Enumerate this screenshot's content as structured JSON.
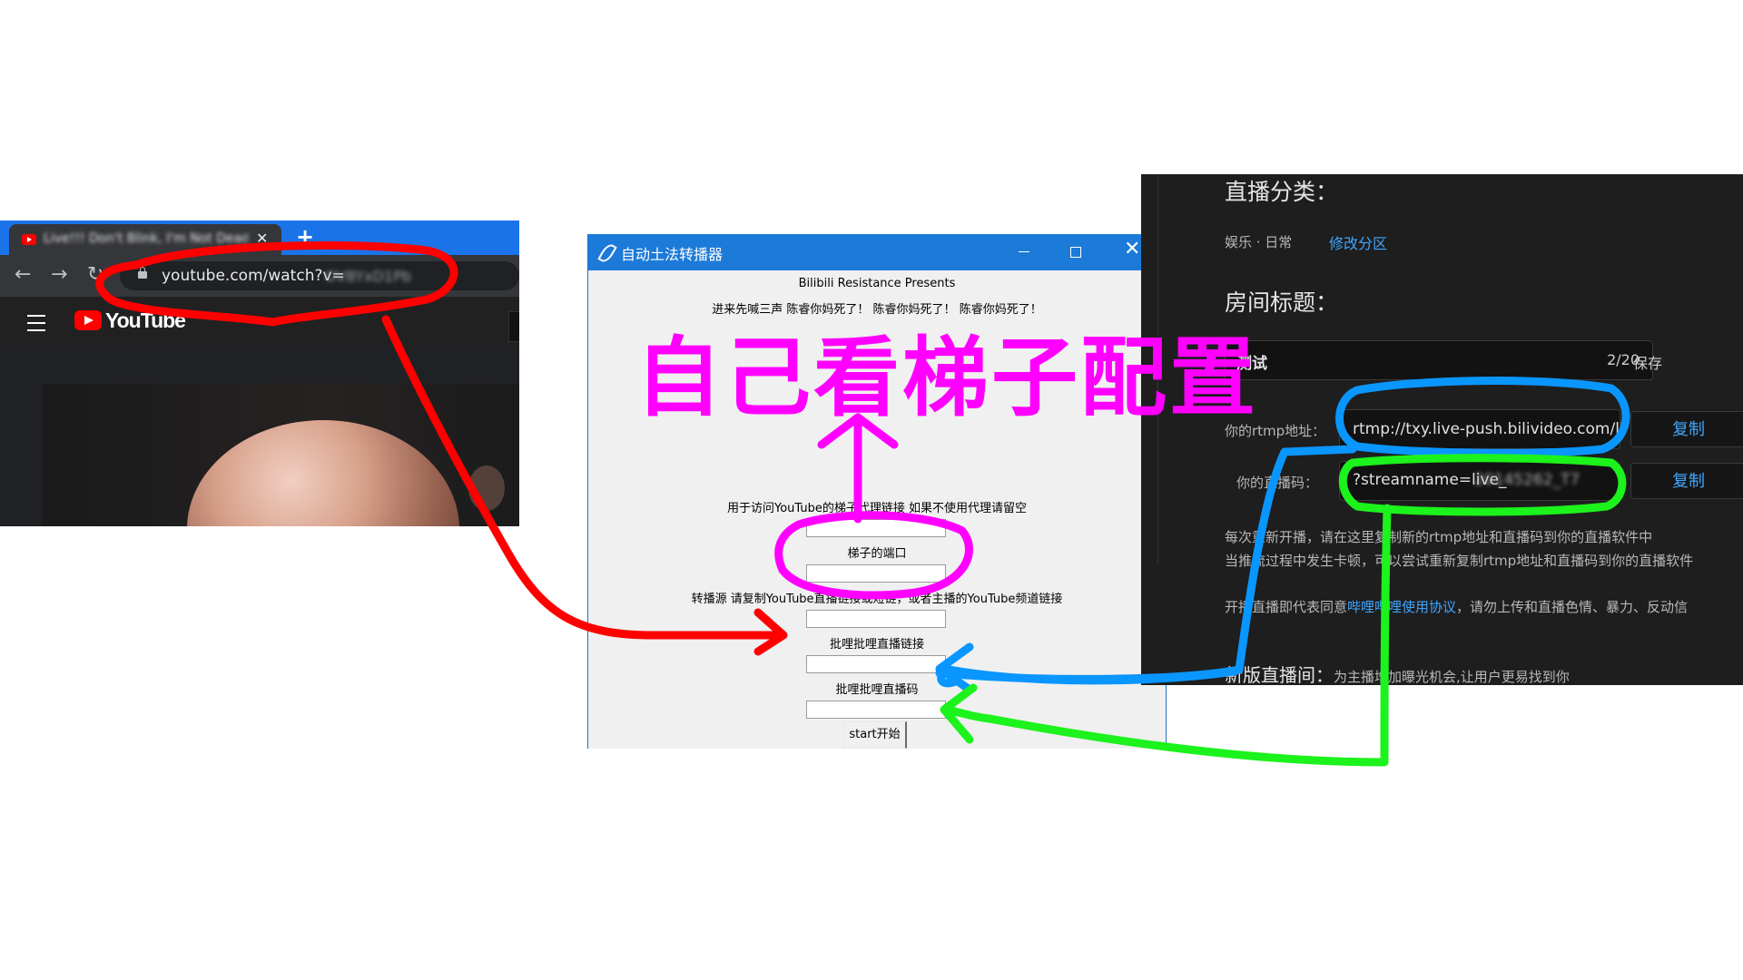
{
  "browser": {
    "tab_title": "Live!!! Don't Blink, I'm Not Dead!",
    "url_visible": "youtube.com/watch?v=",
    "url_blurred": "OVBYxD1Pb",
    "site_logo_text": "YouTube",
    "icons": [
      "youtube-favicon",
      "close-icon",
      "plus-icon",
      "back-arrow-icon",
      "forward-arrow-icon",
      "reload-icon",
      "lock-icon",
      "hamburger-menu-icon",
      "youtube-logo-icon"
    ]
  },
  "app": {
    "window_title": "自动土法转播器",
    "header_line1": "Bilibili Resistance Presents",
    "header_line2": "进来先喊三声 陈睿你妈死了！ 陈睿你妈死了！ 陈睿你妈死了！",
    "proxy_label": "用于访问YouTube的梯子代理链接 如果不使用代理请留空",
    "port_label": "梯子的端口",
    "source_label": "转播源 请复制YouTube直播链接或短链，或者主播的YouTube频道链接",
    "bili_link_label": "批哩批哩直播链接",
    "bili_key_label": "批哩批哩直播码",
    "start_button": "start开始"
  },
  "bili": {
    "category_heading": "直播分类：",
    "category_value": "娱乐 · 日常",
    "change_category_link": "修改分区",
    "room_title_heading": "房间标题：",
    "room_title_value": "测试",
    "title_counter": "2/20",
    "save_label": "保存",
    "rtmp_label": "你的rtmp地址：",
    "rtmp_value": "rtmp://txy.live-push.bilivideo.com/li",
    "stream_key_label": "你的直播码：",
    "stream_key_value": "?streamname=live_",
    "stream_key_blurred": "20145262_T7",
    "copy_label": "复制",
    "notice_line1": "每次重新开播，请在这里复制新的rtmp地址和直播码到你的直播软件中",
    "notice_line2": "当推流过程中发生卡顿，可以尝试重新复制rtmp地址和直播码到你的直播软件",
    "agreement_prefix": "开播直播即代表同意",
    "agreement_link": "哔哩哔哩使用协议",
    "agreement_suffix": "，请勿上传和直播色情、暴力、反动信",
    "new_room_heading": "新版直播间：",
    "new_room_desc": "为主播增加曝光机会,让用户更易找到你"
  },
  "annotation": {
    "text": "自己看梯子配置",
    "colors": {
      "red": "#ff0000",
      "magenta": "#ff00ff",
      "blue": "#0a96ff",
      "green": "#1cf21c"
    }
  }
}
